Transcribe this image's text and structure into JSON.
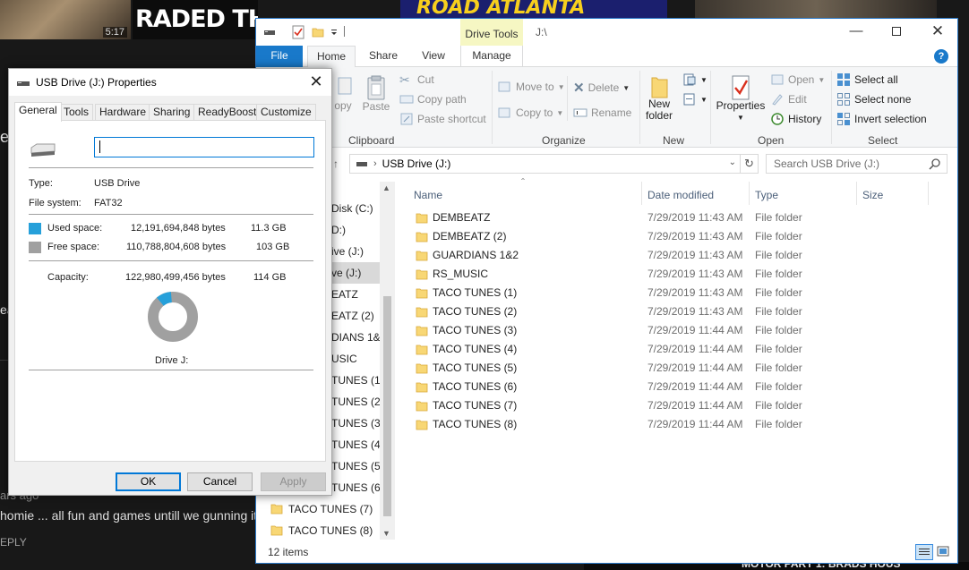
{
  "background": {
    "thumb1_duration": "5:17",
    "thumb2_text": "RADED THE CIVIC",
    "thumb3_text": "ROAD ATLANTA",
    "left_fragments": [
      "e",
      "ea"
    ],
    "comment_age": "ars ago",
    "comment_text": "homie ... all fun and games untill we gunning it",
    "reply_label": "EPLY",
    "bottom_video_title": "MOTOR PART 1: BRADS HOUS"
  },
  "explorer": {
    "title_path": "J:\\",
    "contextual_tab": "Drive Tools",
    "tabs": {
      "file": "File",
      "home": "Home",
      "share": "Share",
      "view": "View",
      "manage": "Manage"
    },
    "ribbon": {
      "clipboard": {
        "copy": "opy",
        "paste": "Paste",
        "cut": "Cut",
        "copy_path": "Copy path",
        "paste_shortcut": "Paste shortcut",
        "label": "Clipboard"
      },
      "organize": {
        "move_to": "Move to",
        "copy_to": "Copy to",
        "delete": "Delete",
        "rename": "Rename",
        "label": "Organize"
      },
      "new": {
        "new_folder_line1": "New",
        "new_folder_line2": "folder",
        "label": "New"
      },
      "open": {
        "properties": "Properties",
        "open": "Open",
        "edit": "Edit",
        "history": "History",
        "label": "Open"
      },
      "select": {
        "select_all": "Select all",
        "select_none": "Select none",
        "invert_selection": "Invert selection",
        "label": "Select"
      }
    },
    "address": {
      "path": "USB Drive (J:)",
      "search_placeholder": "Search USB Drive (J:)"
    },
    "nav_items": [
      {
        "label": "Disk (C:)",
        "selected": false
      },
      {
        "label": "D:)",
        "selected": false
      },
      {
        "label": "ive (J:)",
        "selected": false
      },
      {
        "label": "ve (J:)",
        "selected": true
      },
      {
        "label": "EATZ",
        "selected": false
      },
      {
        "label": "EATZ (2)",
        "selected": false
      },
      {
        "label": "DIANS 1&2",
        "selected": false
      },
      {
        "label": "USIC",
        "selected": false
      },
      {
        "label": "TUNES (1)",
        "selected": false
      },
      {
        "label": "TUNES (2)",
        "selected": false
      },
      {
        "label": "TUNES (3)",
        "selected": false
      },
      {
        "label": "TUNES (4)",
        "selected": false
      },
      {
        "label": "TUNES (5)",
        "selected": false
      },
      {
        "label": "TUNES (6)",
        "selected": false
      },
      {
        "label": "TACO TUNES (7)",
        "selected": false
      },
      {
        "label": "TACO TUNES (8)",
        "selected": false
      }
    ],
    "columns": {
      "name": "Name",
      "date": "Date modified",
      "type": "Type",
      "size": "Size"
    },
    "files": [
      {
        "name": "DEMBEATZ",
        "date": "7/29/2019 11:43 AM",
        "type": "File folder"
      },
      {
        "name": "DEMBEATZ (2)",
        "date": "7/29/2019 11:43 AM",
        "type": "File folder"
      },
      {
        "name": "GUARDIANS 1&2",
        "date": "7/29/2019 11:43 AM",
        "type": "File folder"
      },
      {
        "name": "RS_MUSIC",
        "date": "7/29/2019 11:43 AM",
        "type": "File folder"
      },
      {
        "name": "TACO TUNES (1)",
        "date": "7/29/2019 11:43 AM",
        "type": "File folder"
      },
      {
        "name": "TACO TUNES (2)",
        "date": "7/29/2019 11:43 AM",
        "type": "File folder"
      },
      {
        "name": "TACO TUNES (3)",
        "date": "7/29/2019 11:44 AM",
        "type": "File folder"
      },
      {
        "name": "TACO TUNES (4)",
        "date": "7/29/2019 11:44 AM",
        "type": "File folder"
      },
      {
        "name": "TACO TUNES (5)",
        "date": "7/29/2019 11:44 AM",
        "type": "File folder"
      },
      {
        "name": "TACO TUNES (6)",
        "date": "7/29/2019 11:44 AM",
        "type": "File folder"
      },
      {
        "name": "TACO TUNES (7)",
        "date": "7/29/2019 11:44 AM",
        "type": "File folder"
      },
      {
        "name": "TACO TUNES (8)",
        "date": "7/29/2019 11:44 AM",
        "type": "File folder"
      }
    ],
    "status": "12 items"
  },
  "properties": {
    "title": "USB Drive (J:) Properties",
    "tabs": [
      "General",
      "Tools",
      "Hardware",
      "Sharing",
      "ReadyBoost",
      "Customize"
    ],
    "drive_name_value": "",
    "type_label": "Type:",
    "type_value": "USB Drive",
    "fs_label": "File system:",
    "fs_value": "FAT32",
    "used_label": "Used space:",
    "used_bytes": "12,191,694,848 bytes",
    "used_gb": "11.3 GB",
    "free_label": "Free space:",
    "free_bytes": "110,788,804,608 bytes",
    "free_gb": "103 GB",
    "capacity_label": "Capacity:",
    "capacity_bytes": "122,980,499,456 bytes",
    "capacity_gb": "114 GB",
    "drive_caption": "Drive J:",
    "used_fraction": 0.099,
    "buttons": {
      "ok": "OK",
      "cancel": "Cancel",
      "apply": "Apply"
    },
    "colors": {
      "used": "#26a0da",
      "free": "#a0a0a0"
    }
  }
}
